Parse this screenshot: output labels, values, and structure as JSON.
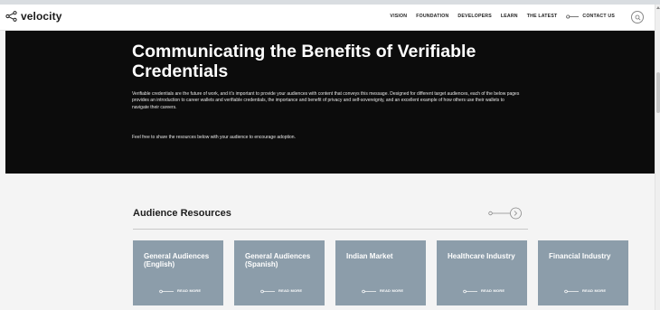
{
  "header": {
    "logo_text": "velocity",
    "nav": [
      {
        "label": "VISION"
      },
      {
        "label": "FOUNDATION"
      },
      {
        "label": "DEVELOPERS"
      },
      {
        "label": "LEARN"
      },
      {
        "label": "THE LATEST"
      }
    ],
    "contact_label": "CONTACT US"
  },
  "hero": {
    "title": "Communicating the Benefits of Verifiable Credentials",
    "body": "Verifiable credentials are the future of work, and it's important to provide your audiences with content that conveys this message. Designed for different target audiences, each of the below pages provides an introduction to career wallets and verifiable credentials, the importance and benefit of privacy and self-sovereignty, and an excellent example of how others use their wallets to navigate their careers.",
    "share": "Feel free to share the resources below with your audience to encourage adoption."
  },
  "resources": {
    "title": "Audience Resources",
    "cards": [
      {
        "title": "General Audiences (English)",
        "cta": "READ MORE"
      },
      {
        "title": "General Audiences (Spanish)",
        "cta": "READ MORE"
      },
      {
        "title": "Indian Market",
        "cta": "READ MORE"
      },
      {
        "title": "Healthcare Industry",
        "cta": "READ MORE"
      },
      {
        "title": "Financial Industry",
        "cta": "READ MORE"
      }
    ]
  },
  "colors": {
    "hero_bg": "#0c0c0c",
    "card_bg": "#8c9daa",
    "page_bg": "#f4f4f4"
  },
  "icons": {
    "logo": "share-nodes-icon",
    "search": "search-icon",
    "arrow": "arrow-right-circle-icon"
  }
}
